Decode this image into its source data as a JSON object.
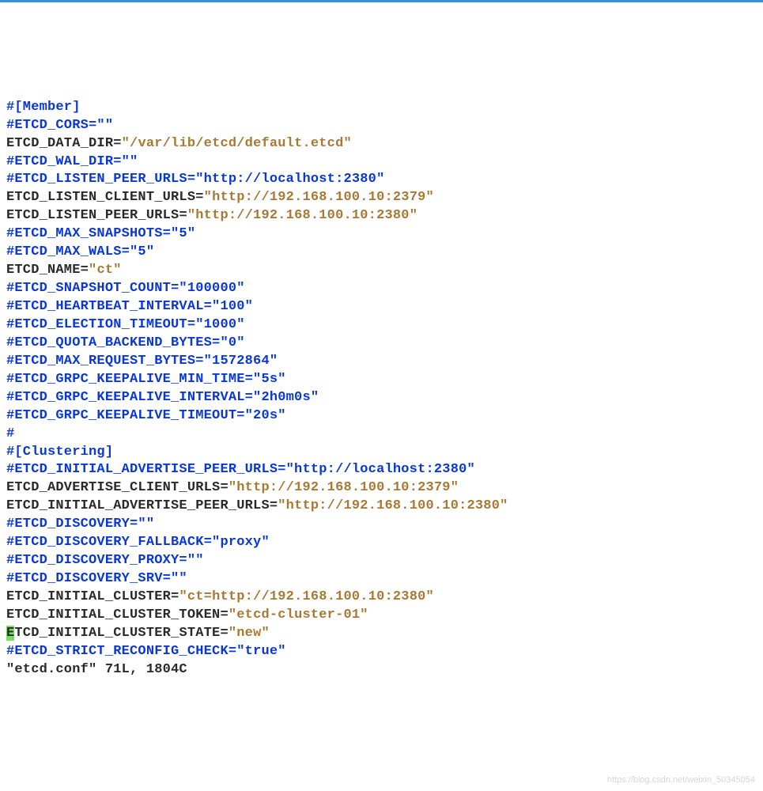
{
  "lines": [
    {
      "type": "comment",
      "text": "#[Member]"
    },
    {
      "type": "comment",
      "text": "#ETCD_CORS=\"\""
    },
    {
      "type": "kv",
      "key": "ETCD_DATA_DIR",
      "value": "/var/lib/etcd/default.etcd"
    },
    {
      "type": "comment",
      "text": "#ETCD_WAL_DIR=\"\""
    },
    {
      "type": "comment",
      "text": "#ETCD_LISTEN_PEER_URLS=\"http://localhost:2380\""
    },
    {
      "type": "kv",
      "key": "ETCD_LISTEN_CLIENT_URLS",
      "value": "http://192.168.100.10:2379"
    },
    {
      "type": "kv",
      "key": "ETCD_LISTEN_PEER_URLS",
      "value": "http://192.168.100.10:2380"
    },
    {
      "type": "comment",
      "text": "#ETCD_MAX_SNAPSHOTS=\"5\""
    },
    {
      "type": "comment",
      "text": "#ETCD_MAX_WALS=\"5\""
    },
    {
      "type": "kv",
      "key": "ETCD_NAME",
      "value": "ct"
    },
    {
      "type": "comment",
      "text": "#ETCD_SNAPSHOT_COUNT=\"100000\""
    },
    {
      "type": "comment",
      "text": "#ETCD_HEARTBEAT_INTERVAL=\"100\""
    },
    {
      "type": "comment",
      "text": "#ETCD_ELECTION_TIMEOUT=\"1000\""
    },
    {
      "type": "comment",
      "text": "#ETCD_QUOTA_BACKEND_BYTES=\"0\""
    },
    {
      "type": "comment",
      "text": "#ETCD_MAX_REQUEST_BYTES=\"1572864\""
    },
    {
      "type": "comment",
      "text": "#ETCD_GRPC_KEEPALIVE_MIN_TIME=\"5s\""
    },
    {
      "type": "comment",
      "text": "#ETCD_GRPC_KEEPALIVE_INTERVAL=\"2h0m0s\""
    },
    {
      "type": "comment",
      "text": "#ETCD_GRPC_KEEPALIVE_TIMEOUT=\"20s\""
    },
    {
      "type": "comment",
      "text": "#"
    },
    {
      "type": "comment",
      "text": "#[Clustering]"
    },
    {
      "type": "comment",
      "text": "#ETCD_INITIAL_ADVERTISE_PEER_URLS=\"http://localhost:2380\""
    },
    {
      "type": "kv",
      "key": "ETCD_ADVERTISE_CLIENT_URLS",
      "value": "http://192.168.100.10:2379"
    },
    {
      "type": "kv",
      "key": "ETCD_INITIAL_ADVERTISE_PEER_URLS",
      "value": "http://192.168.100.10:2380"
    },
    {
      "type": "comment",
      "text": "#ETCD_DISCOVERY=\"\""
    },
    {
      "type": "comment",
      "text": "#ETCD_DISCOVERY_FALLBACK=\"proxy\""
    },
    {
      "type": "comment",
      "text": "#ETCD_DISCOVERY_PROXY=\"\""
    },
    {
      "type": "comment",
      "text": "#ETCD_DISCOVERY_SRV=\"\""
    },
    {
      "type": "kv",
      "key": "ETCD_INITIAL_CLUSTER",
      "value": "ct=http://192.168.100.10:2380"
    },
    {
      "type": "kv",
      "key": "ETCD_INITIAL_CLUSTER_TOKEN",
      "value": "etcd-cluster-01"
    },
    {
      "type": "kv_cursor",
      "key": "ETCD_INITIAL_CLUSTER_STATE",
      "value": "new"
    },
    {
      "type": "comment",
      "text": "#ETCD_STRICT_RECONFIG_CHECK=\"true\""
    }
  ],
  "status": "\"etcd.conf\" 71L, 1804C",
  "watermark": "https://blog.csdn.net/weixin_50345054"
}
